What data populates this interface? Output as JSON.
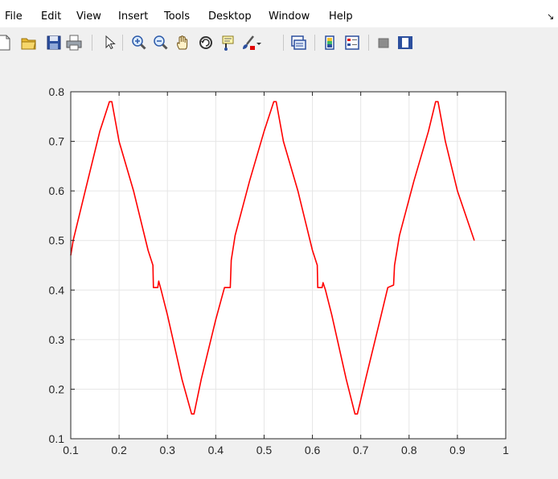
{
  "menu": {
    "items": [
      "File",
      "Edit",
      "View",
      "Insert",
      "Tools",
      "Desktop",
      "Window",
      "Help"
    ],
    "dock_arrow": "↘"
  },
  "toolbar": {
    "icons": [
      "new-figure-icon",
      "open-file-icon",
      "save-icon",
      "print-icon",
      "pointer-icon",
      "zoom-in-icon",
      "zoom-out-icon",
      "pan-icon",
      "rotate-3d-icon",
      "data-cursor-icon",
      "brush-icon",
      "dropdown-icon",
      "link-plot-icon",
      "colorbar-icon",
      "legend-icon",
      "hide-plot-tools-icon",
      "show-plot-tools-icon"
    ]
  },
  "chart_data": {
    "type": "line",
    "title": "",
    "xlabel": "",
    "ylabel": "",
    "xlim": [
      0.1,
      1.0
    ],
    "ylim": [
      0.1,
      0.8
    ],
    "xticks": [
      "0.1",
      "0.2",
      "0.3",
      "0.4",
      "0.5",
      "0.6",
      "0.7",
      "0.8",
      "0.9",
      "1"
    ],
    "yticks": [
      "0.1",
      "0.2",
      "0.3",
      "0.4",
      "0.5",
      "0.6",
      "0.7",
      "0.8"
    ],
    "grid": true,
    "line_color": "#ff0000",
    "x": [
      0.1,
      0.105,
      0.13,
      0.16,
      0.18,
      0.185,
      0.2,
      0.23,
      0.26,
      0.27,
      0.271,
      0.28,
      0.282,
      0.287,
      0.3,
      0.33,
      0.35,
      0.355,
      0.37,
      0.4,
      0.418,
      0.43,
      0.432,
      0.44,
      0.47,
      0.5,
      0.52,
      0.525,
      0.54,
      0.57,
      0.6,
      0.61,
      0.611,
      0.62,
      0.622,
      0.627,
      0.64,
      0.67,
      0.688,
      0.693,
      0.71,
      0.74,
      0.756,
      0.768,
      0.77,
      0.78,
      0.81,
      0.84,
      0.855,
      0.86,
      0.875,
      0.9,
      0.935
    ],
    "y": [
      0.47,
      0.5,
      0.6,
      0.72,
      0.78,
      0.78,
      0.7,
      0.6,
      0.48,
      0.45,
      0.405,
      0.405,
      0.418,
      0.4,
      0.35,
      0.22,
      0.15,
      0.15,
      0.22,
      0.34,
      0.405,
      0.405,
      0.46,
      0.51,
      0.62,
      0.72,
      0.78,
      0.78,
      0.7,
      0.6,
      0.48,
      0.45,
      0.405,
      0.405,
      0.415,
      0.4,
      0.35,
      0.22,
      0.15,
      0.15,
      0.22,
      0.34,
      0.405,
      0.41,
      0.45,
      0.51,
      0.62,
      0.72,
      0.78,
      0.78,
      0.7,
      0.6,
      0.5
    ]
  }
}
